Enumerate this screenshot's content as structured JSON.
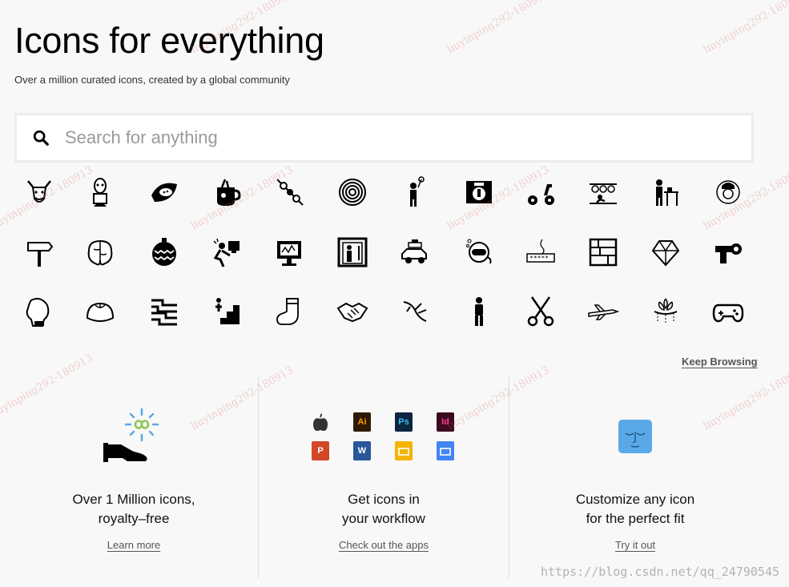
{
  "hero": {
    "title": "Icons for everything",
    "subtitle": "Over a million curated icons, created by a global community"
  },
  "search": {
    "placeholder": "Search for anything",
    "value": ""
  },
  "icon_rows": [
    [
      "jester-face-icon",
      "cartoon-man-icon",
      "papaya-icon",
      "drink-cup-icon",
      "kebab-skewer-icon",
      "target-rings-icon",
      "person-with-balloon-icon",
      "scale-box-icon",
      "scooter-icon",
      "shelf-with-person-icon",
      "person-at-desk-icon",
      "chef-portrait-icon"
    ],
    [
      "signpost-icon",
      "brain-icon",
      "ornament-bauble-icon",
      "stressed-worker-icon",
      "computer-stethoscope-icon",
      "elevator-person-icon",
      "car-with-luggage-icon",
      "diver-mask-icon",
      "password-field-icon",
      "shelving-icon",
      "gemstone-icon",
      "flamethrower-icon"
    ],
    [
      "boxing-glove-icon",
      "dumpling-icon",
      "pattern-lines-icon",
      "stairs-person-icon",
      "christmas-stocking-icon",
      "handshake-icon",
      "bird-sketch-icon",
      "standing-person-icon",
      "scissors-icon",
      "airplane-icon",
      "lotus-decoration-icon",
      "game-controller-icon"
    ]
  ],
  "keep_browsing_label": "Keep Browsing",
  "features": [
    {
      "title": "Over 1 Million icons,\nroyalty–free",
      "link": "Learn more",
      "art": "hand-infinity-icon"
    },
    {
      "title": "Get icons in\nyour workflow",
      "link": "Check out the apps",
      "art": "app-icons-grid"
    },
    {
      "title": "Customize any icon\nfor the perfect fit",
      "link": "Try it out",
      "art": "blue-face-icon"
    }
  ],
  "apps": [
    {
      "name": "apple-icon",
      "label": "",
      "color": "#333333"
    },
    {
      "name": "illustrator-icon",
      "label": "Ai",
      "color": "#2e1a04"
    },
    {
      "name": "photoshop-icon",
      "label": "Ps",
      "color": "#0c2540"
    },
    {
      "name": "indesign-icon",
      "label": "Id",
      "color": "#3b0a1e"
    },
    {
      "name": "powerpoint-icon",
      "label": "P",
      "color": "#d24726"
    },
    {
      "name": "word-icon",
      "label": "W",
      "color": "#2b579a"
    },
    {
      "name": "slides-icon",
      "label": "",
      "color": "#f4b400"
    },
    {
      "name": "docs-icon",
      "label": "",
      "color": "#4285f4"
    }
  ],
  "watermark_text": "liuyinping292-180913",
  "url_watermark": "https://blog.csdn.net/qq_24790545"
}
